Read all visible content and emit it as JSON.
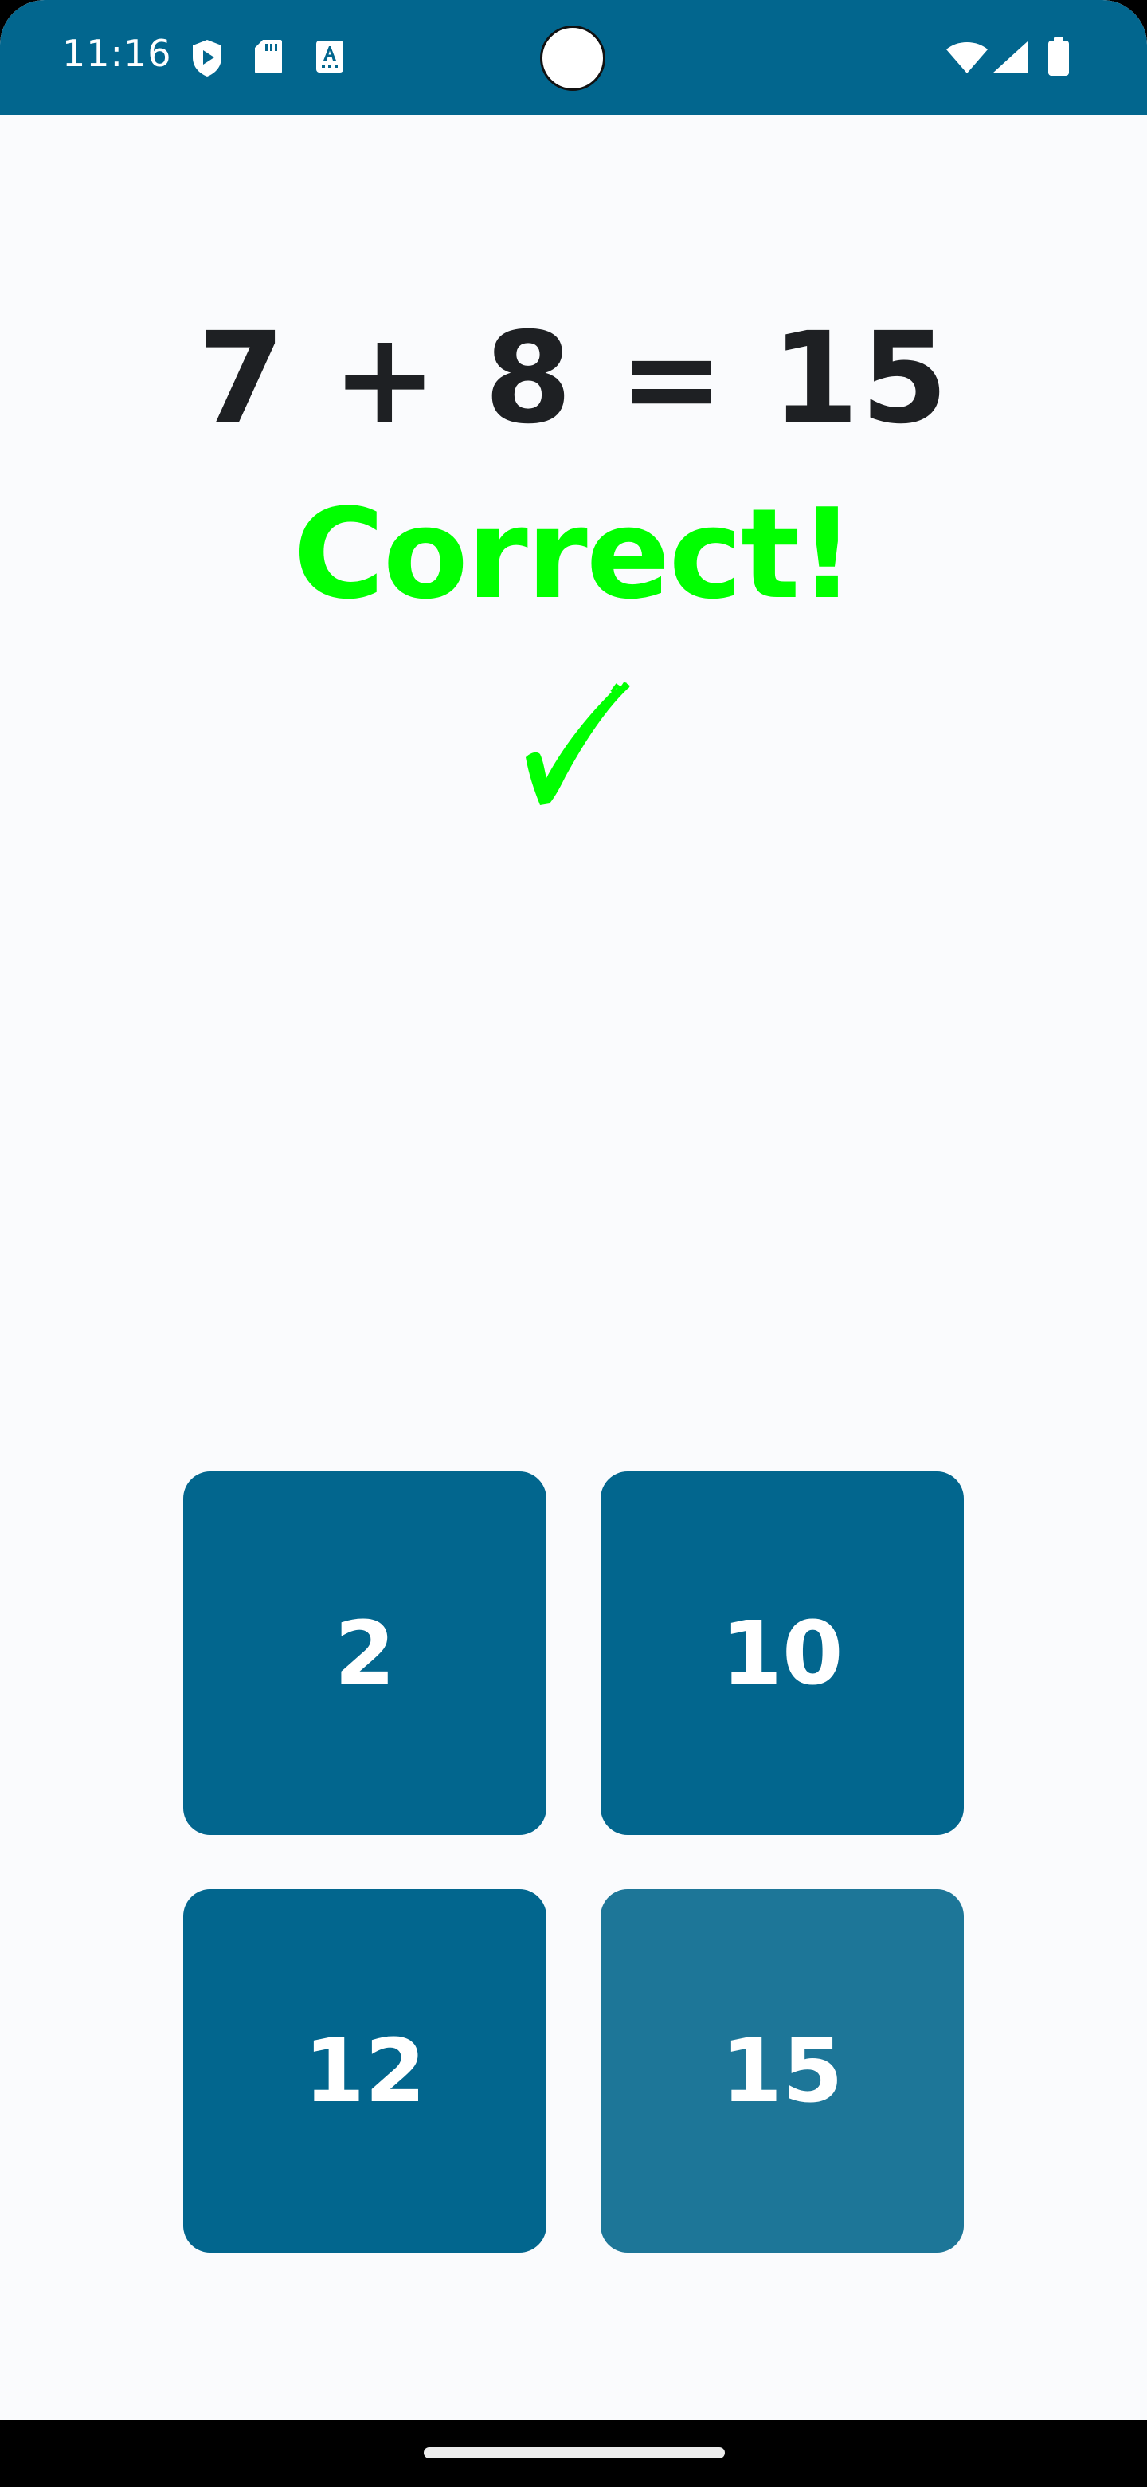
{
  "status_bar": {
    "time": "11:16",
    "color": "#02668E",
    "left_icons": [
      "play-protect-icon",
      "sd-card-icon",
      "accessibility-font-icon"
    ],
    "right_icons": [
      "wifi-icon",
      "cell-signal-icon",
      "battery-icon"
    ]
  },
  "quiz": {
    "equation": "7 + 8 = 15",
    "feedback": "Correct!",
    "feedback_color": "#00FF00",
    "feedback_icon": "checkmark-icon"
  },
  "answers": [
    {
      "label": "2",
      "selected": false
    },
    {
      "label": "10",
      "selected": false
    },
    {
      "label": "12",
      "selected": false
    },
    {
      "label": "15",
      "selected": true
    }
  ],
  "colors": {
    "primary": "#02668E",
    "selected": "#1D7698",
    "background": "#FAFBFD",
    "text": "#1E2023"
  }
}
